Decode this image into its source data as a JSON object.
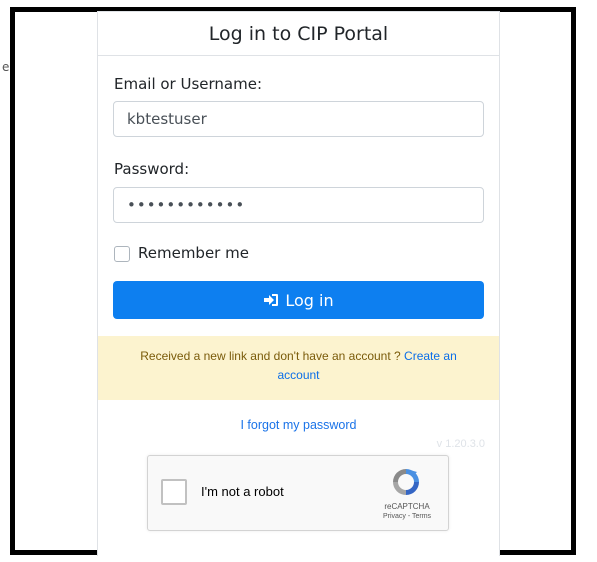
{
  "stray_char": "e",
  "header": {
    "title": "Log in to CIP Portal"
  },
  "form": {
    "username_label": "Email or Username:",
    "username_value": "kbtestuser",
    "password_label": "Password:",
    "password_value": "••••••••••••",
    "remember_label": "Remember me",
    "remember_checked": false,
    "login_label": "Log in"
  },
  "notice": {
    "text": "Received a new link and don't have an account ? ",
    "link": "Create an account"
  },
  "forgot_link": "I forgot my password",
  "version": "v 1.20.3.0",
  "recaptcha": {
    "label": "I'm not a robot",
    "brand": "reCAPTCHA",
    "links": "Privacy - Terms"
  },
  "colors": {
    "primary": "#0d7ff0",
    "notice_bg": "#fcf3cf",
    "link": "#0b6ee8"
  }
}
